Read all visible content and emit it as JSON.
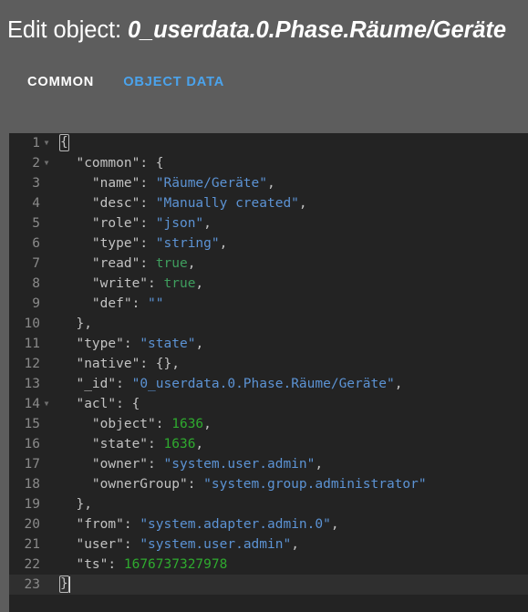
{
  "header": {
    "prefix": "Edit object: ",
    "object_id": "0_userdata.0.Phase.Räume/Geräte"
  },
  "tabs": [
    {
      "label": "COMMON",
      "active": false
    },
    {
      "label": "OBJECT DATA",
      "active": true
    }
  ],
  "colors": {
    "accent": "#4ba3ec",
    "header_bg": "#5d5d5d",
    "editor_bg": "#232323",
    "gutter_bg": "#232323",
    "active_line_bg": "#2f2f2f",
    "string": "#5c93d4",
    "boolean": "#3f9e5e",
    "number": "#2faa2f",
    "key": "#c2c2c2",
    "line_number": "#8a8a8a"
  },
  "editor": {
    "language": "json",
    "active_line": 23,
    "fold_lines": [
      1,
      2,
      14
    ],
    "lines": [
      {
        "n": 1,
        "fold": true,
        "tokens": [
          {
            "t": "{",
            "c": "brace",
            "match": true
          }
        ]
      },
      {
        "n": 2,
        "fold": true,
        "tokens": [
          {
            "t": "  ",
            "c": "punct"
          },
          {
            "t": "\"common\"",
            "c": "key"
          },
          {
            "t": ": ",
            "c": "punct"
          },
          {
            "t": "{",
            "c": "brace"
          }
        ]
      },
      {
        "n": 3,
        "fold": false,
        "tokens": [
          {
            "t": "    ",
            "c": "punct"
          },
          {
            "t": "\"name\"",
            "c": "key"
          },
          {
            "t": ": ",
            "c": "punct"
          },
          {
            "t": "\"Räume/Geräte\"",
            "c": "str"
          },
          {
            "t": ",",
            "c": "punct"
          }
        ]
      },
      {
        "n": 4,
        "fold": false,
        "tokens": [
          {
            "t": "    ",
            "c": "punct"
          },
          {
            "t": "\"desc\"",
            "c": "key"
          },
          {
            "t": ": ",
            "c": "punct"
          },
          {
            "t": "\"Manually created\"",
            "c": "str"
          },
          {
            "t": ",",
            "c": "punct"
          }
        ]
      },
      {
        "n": 5,
        "fold": false,
        "tokens": [
          {
            "t": "    ",
            "c": "punct"
          },
          {
            "t": "\"role\"",
            "c": "key"
          },
          {
            "t": ": ",
            "c": "punct"
          },
          {
            "t": "\"json\"",
            "c": "str"
          },
          {
            "t": ",",
            "c": "punct"
          }
        ]
      },
      {
        "n": 6,
        "fold": false,
        "tokens": [
          {
            "t": "    ",
            "c": "punct"
          },
          {
            "t": "\"type\"",
            "c": "key"
          },
          {
            "t": ": ",
            "c": "punct"
          },
          {
            "t": "\"string\"",
            "c": "str"
          },
          {
            "t": ",",
            "c": "punct"
          }
        ]
      },
      {
        "n": 7,
        "fold": false,
        "tokens": [
          {
            "t": "    ",
            "c": "punct"
          },
          {
            "t": "\"read\"",
            "c": "key"
          },
          {
            "t": ": ",
            "c": "punct"
          },
          {
            "t": "true",
            "c": "bool"
          },
          {
            "t": ",",
            "c": "punct"
          }
        ]
      },
      {
        "n": 8,
        "fold": false,
        "tokens": [
          {
            "t": "    ",
            "c": "punct"
          },
          {
            "t": "\"write\"",
            "c": "key"
          },
          {
            "t": ": ",
            "c": "punct"
          },
          {
            "t": "true",
            "c": "bool"
          },
          {
            "t": ",",
            "c": "punct"
          }
        ]
      },
      {
        "n": 9,
        "fold": false,
        "tokens": [
          {
            "t": "    ",
            "c": "punct"
          },
          {
            "t": "\"def\"",
            "c": "key"
          },
          {
            "t": ": ",
            "c": "punct"
          },
          {
            "t": "\"\"",
            "c": "str"
          }
        ]
      },
      {
        "n": 10,
        "fold": false,
        "tokens": [
          {
            "t": "  ",
            "c": "punct"
          },
          {
            "t": "}",
            "c": "brace"
          },
          {
            "t": ",",
            "c": "punct"
          }
        ]
      },
      {
        "n": 11,
        "fold": false,
        "tokens": [
          {
            "t": "  ",
            "c": "punct"
          },
          {
            "t": "\"type\"",
            "c": "key"
          },
          {
            "t": ": ",
            "c": "punct"
          },
          {
            "t": "\"state\"",
            "c": "str"
          },
          {
            "t": ",",
            "c": "punct"
          }
        ]
      },
      {
        "n": 12,
        "fold": false,
        "tokens": [
          {
            "t": "  ",
            "c": "punct"
          },
          {
            "t": "\"native\"",
            "c": "key"
          },
          {
            "t": ": ",
            "c": "punct"
          },
          {
            "t": "{}",
            "c": "brace"
          },
          {
            "t": ",",
            "c": "punct"
          }
        ]
      },
      {
        "n": 13,
        "fold": false,
        "tokens": [
          {
            "t": "  ",
            "c": "punct"
          },
          {
            "t": "\"_id\"",
            "c": "key"
          },
          {
            "t": ": ",
            "c": "punct"
          },
          {
            "t": "\"0_userdata.0.Phase.Räume/Geräte\"",
            "c": "str"
          },
          {
            "t": ",",
            "c": "punct"
          }
        ]
      },
      {
        "n": 14,
        "fold": true,
        "tokens": [
          {
            "t": "  ",
            "c": "punct"
          },
          {
            "t": "\"acl\"",
            "c": "key"
          },
          {
            "t": ": ",
            "c": "punct"
          },
          {
            "t": "{",
            "c": "brace"
          }
        ]
      },
      {
        "n": 15,
        "fold": false,
        "tokens": [
          {
            "t": "    ",
            "c": "punct"
          },
          {
            "t": "\"object\"",
            "c": "key"
          },
          {
            "t": ": ",
            "c": "punct"
          },
          {
            "t": "1636",
            "c": "num"
          },
          {
            "t": ",",
            "c": "punct"
          }
        ]
      },
      {
        "n": 16,
        "fold": false,
        "tokens": [
          {
            "t": "    ",
            "c": "punct"
          },
          {
            "t": "\"state\"",
            "c": "key"
          },
          {
            "t": ": ",
            "c": "punct"
          },
          {
            "t": "1636",
            "c": "num"
          },
          {
            "t": ",",
            "c": "punct"
          }
        ]
      },
      {
        "n": 17,
        "fold": false,
        "tokens": [
          {
            "t": "    ",
            "c": "punct"
          },
          {
            "t": "\"owner\"",
            "c": "key"
          },
          {
            "t": ": ",
            "c": "punct"
          },
          {
            "t": "\"system.user.admin\"",
            "c": "str"
          },
          {
            "t": ",",
            "c": "punct"
          }
        ]
      },
      {
        "n": 18,
        "fold": false,
        "tokens": [
          {
            "t": "    ",
            "c": "punct"
          },
          {
            "t": "\"ownerGroup\"",
            "c": "key"
          },
          {
            "t": ": ",
            "c": "punct"
          },
          {
            "t": "\"system.group.administrator\"",
            "c": "str"
          }
        ]
      },
      {
        "n": 19,
        "fold": false,
        "tokens": [
          {
            "t": "  ",
            "c": "punct"
          },
          {
            "t": "}",
            "c": "brace"
          },
          {
            "t": ",",
            "c": "punct"
          }
        ]
      },
      {
        "n": 20,
        "fold": false,
        "tokens": [
          {
            "t": "  ",
            "c": "punct"
          },
          {
            "t": "\"from\"",
            "c": "key"
          },
          {
            "t": ": ",
            "c": "punct"
          },
          {
            "t": "\"system.adapter.admin.0\"",
            "c": "str"
          },
          {
            "t": ",",
            "c": "punct"
          }
        ]
      },
      {
        "n": 21,
        "fold": false,
        "tokens": [
          {
            "t": "  ",
            "c": "punct"
          },
          {
            "t": "\"user\"",
            "c": "key"
          },
          {
            "t": ": ",
            "c": "punct"
          },
          {
            "t": "\"system.user.admin\"",
            "c": "str"
          },
          {
            "t": ",",
            "c": "punct"
          }
        ]
      },
      {
        "n": 22,
        "fold": false,
        "tokens": [
          {
            "t": "  ",
            "c": "punct"
          },
          {
            "t": "\"ts\"",
            "c": "key"
          },
          {
            "t": ": ",
            "c": "punct"
          },
          {
            "t": "1676737327978",
            "c": "num"
          }
        ]
      },
      {
        "n": 23,
        "fold": false,
        "caret": true,
        "tokens": [
          {
            "t": "}",
            "c": "brace",
            "match": true
          }
        ]
      }
    ]
  }
}
